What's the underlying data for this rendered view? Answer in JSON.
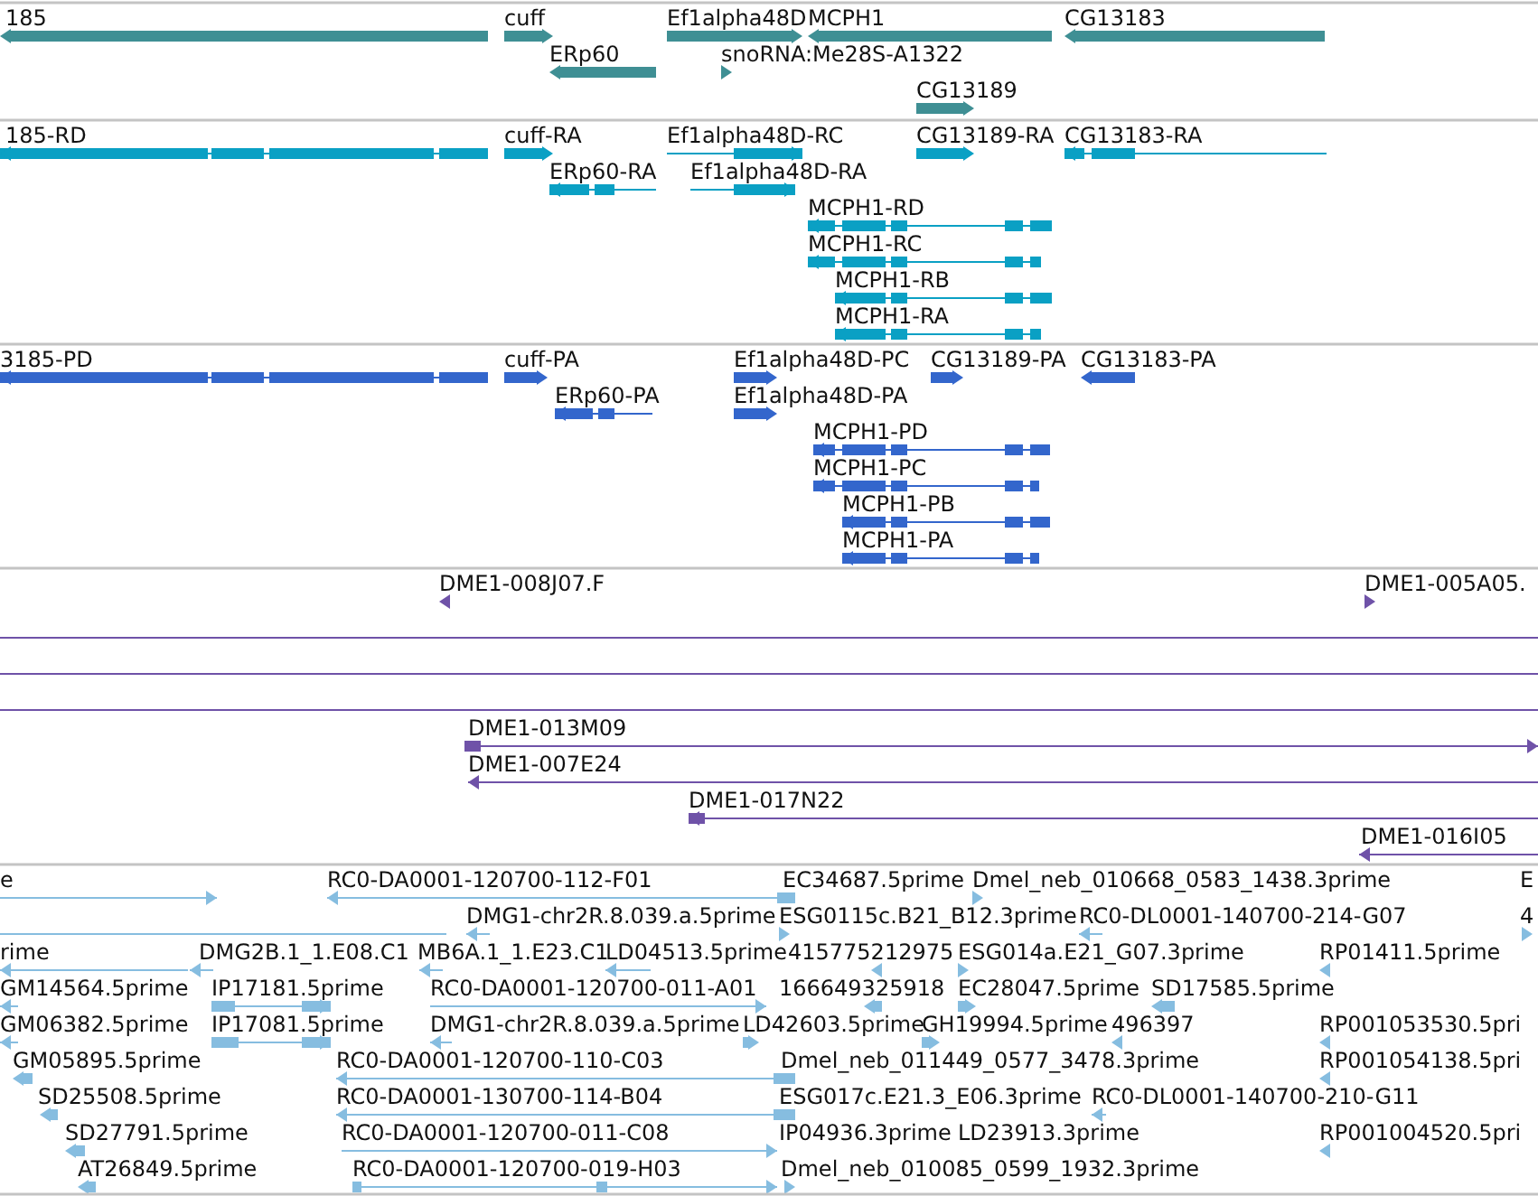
{
  "tracks": [
    {
      "kind": "gene",
      "features": [
        {
          "label": "185",
          "reverse": true
        },
        {
          "label": "cuff",
          "reverse": false
        },
        {
          "label": "Ef1alpha48D",
          "reverse": false
        },
        {
          "label": "MCPH1",
          "reverse": true
        },
        {
          "label": "CG13183",
          "reverse": true
        },
        {
          "label": "ERp60",
          "reverse": true
        },
        {
          "label": "snoRNA:Me28S-A1322",
          "reverse": false
        },
        {
          "label": "CG13189",
          "reverse": false
        }
      ]
    },
    {
      "kind": "transcript",
      "features": [
        {
          "label": "185-RD",
          "reverse": true
        },
        {
          "label": "cuff-RA",
          "reverse": false
        },
        {
          "label": "Ef1alpha48D-RC",
          "reverse": false
        },
        {
          "label": "CG13189-RA",
          "reverse": false
        },
        {
          "label": "CG13183-RA",
          "reverse": true
        },
        {
          "label": "ERp60-RA",
          "reverse": true
        },
        {
          "label": "Ef1alpha48D-RA",
          "reverse": false
        },
        {
          "label": "MCPH1-RD",
          "reverse": true
        },
        {
          "label": "MCPH1-RC",
          "reverse": true
        },
        {
          "label": "MCPH1-RB",
          "reverse": true
        },
        {
          "label": "MCPH1-RA",
          "reverse": true
        }
      ]
    },
    {
      "kind": "protein",
      "features": [
        {
          "label": "3185-PD",
          "reverse": true
        },
        {
          "label": "cuff-PA",
          "reverse": false
        },
        {
          "label": "Ef1alpha48D-PC",
          "reverse": false
        },
        {
          "label": "CG13189-PA",
          "reverse": false
        },
        {
          "label": "CG13183-PA",
          "reverse": true
        },
        {
          "label": "ERp60-PA",
          "reverse": true
        },
        {
          "label": "Ef1alpha48D-PA",
          "reverse": false
        },
        {
          "label": "MCPH1-PD",
          "reverse": true
        },
        {
          "label": "MCPH1-PC",
          "reverse": true
        },
        {
          "label": "MCPH1-PB",
          "reverse": true
        },
        {
          "label": "MCPH1-PA",
          "reverse": true
        }
      ]
    },
    {
      "kind": "clone",
      "features": [
        {
          "label": "DME1-008J07.F",
          "reverse": true
        },
        {
          "label": "DME1-005A05.",
          "reverse": false
        },
        {
          "label": "DME1-013M09",
          "reverse": false
        },
        {
          "label": "DME1-007E24",
          "reverse": true
        },
        {
          "label": "DME1-017N22",
          "reverse": true
        },
        {
          "label": "DME1-016I05",
          "reverse": true
        }
      ]
    },
    {
      "kind": "est",
      "features": [
        {
          "label": "e",
          "reverse": false
        },
        {
          "label": "RC0-DA0001-120700-112-F01",
          "reverse": true
        },
        {
          "label": "EC34687.5prime"
        },
        {
          "label": "Dmel_neb_010668_0583_1438.3prime",
          "reverse": false
        },
        {
          "label": "E"
        },
        {
          "label": "DMG1-chr2R.8.039.a.5prime",
          "reverse": true
        },
        {
          "label": "ESG0115c.B21_B12.3prime",
          "reverse": false
        },
        {
          "label": "RC0-DL0001-140700-214-G07",
          "reverse": true
        },
        {
          "label": "4",
          "reverse": false
        },
        {
          "label": "rime",
          "reverse": true
        },
        {
          "label": "DMG2B.1_1.E08.C1",
          "reverse": true
        },
        {
          "label": "MB6A.1_1.E23.C1",
          "reverse": true
        },
        {
          "label": "LD04513.5prime",
          "reverse": true
        },
        {
          "label": "415775212975",
          "reverse": true
        },
        {
          "label": "ESG014a.E21_G07.3prime",
          "reverse": false
        },
        {
          "label": "RP01411.5prime",
          "reverse": true
        },
        {
          "label": "GM14564.5prime",
          "reverse": true
        },
        {
          "label": "IP17181.5prime",
          "reverse": false
        },
        {
          "label": "RC0-DA0001-120700-011-A01",
          "reverse": false
        },
        {
          "label": "166649325918",
          "reverse": true
        },
        {
          "label": "EC28047.5prime",
          "reverse": false
        },
        {
          "label": "SD17585.5prime",
          "reverse": true
        },
        {
          "label": "GM06382.5prime",
          "reverse": true
        },
        {
          "label": "IP17081.5prime",
          "reverse": false
        },
        {
          "label": "DMG1-chr2R.8.039.a.5prime",
          "reverse": true
        },
        {
          "label": "LD42603.5prime",
          "reverse": false
        },
        {
          "label": "GH19994.5prime",
          "reverse": false
        },
        {
          "label": "496397",
          "reverse": true
        },
        {
          "label": "RP001053530.5pri",
          "reverse": true
        },
        {
          "label": "GM05895.5prime",
          "reverse": true
        },
        {
          "label": "RC0-DA0001-120700-110-C03",
          "reverse": true
        },
        {
          "label": "Dmel_neb_011449_0577_3478.3prime"
        },
        {
          "label": "RP001054138.5pri",
          "reverse": true
        },
        {
          "label": "SD25508.5prime",
          "reverse": true
        },
        {
          "label": "RC0-DA0001-130700-114-B04",
          "reverse": true
        },
        {
          "label": "ESG017c.E21.3_E06.3prime"
        },
        {
          "label": "RC0-DL0001-140700-210-G11",
          "reverse": true
        },
        {
          "label": "SD27791.5prime",
          "reverse": true
        },
        {
          "label": "RC0-DA0001-120700-011-C08",
          "reverse": false
        },
        {
          "label": "IP04936.3prime"
        },
        {
          "label": "LD23913.3prime"
        },
        {
          "label": "RP001004520.5pri",
          "reverse": true
        },
        {
          "label": "AT26849.5prime",
          "reverse": true
        },
        {
          "label": "RC0-DA0001-120700-019-H03",
          "reverse": false
        },
        {
          "label": "Dmel_neb_010085_0599_1932.3prime",
          "reverse": false
        }
      ]
    }
  ]
}
